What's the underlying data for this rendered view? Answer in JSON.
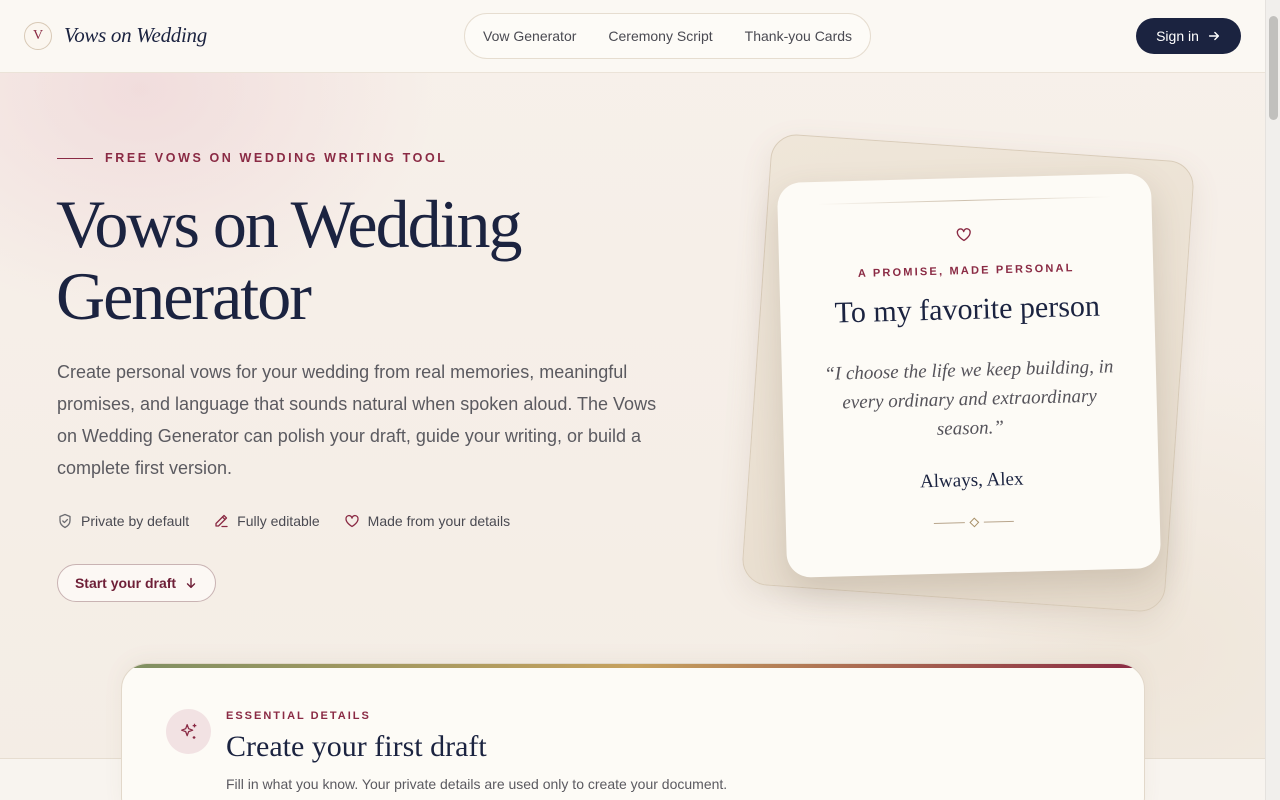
{
  "header": {
    "logo_mark": "V",
    "logo_text": "Vows on Wedding",
    "nav": [
      "Vow Generator",
      "Ceremony Script",
      "Thank-you Cards"
    ],
    "signin_label": "Sign in"
  },
  "hero": {
    "eyebrow": "FREE VOWS ON WEDDING WRITING TOOL",
    "title": "Vows on Wedding Generator",
    "description": "Create personal vows for your wedding from real memories, meaningful promises, and language that sounds natural when spoken aloud. The Vows on Wedding Generator can polish your draft, guide your writing, or build a complete first version.",
    "features": [
      {
        "icon": "shield-check-icon",
        "label": "Private by default"
      },
      {
        "icon": "pencil-icon",
        "label": "Fully editable"
      },
      {
        "icon": "heart-icon",
        "label": "Made from your details"
      }
    ],
    "cta_label": "Start your draft"
  },
  "card": {
    "eyebrow": "A PROMISE, MADE PERSONAL",
    "title": "To my favorite person",
    "quote": "“I choose the life we keep building, in every ordinary and extraordinary season.”",
    "signature": "Always, Alex"
  },
  "form": {
    "eyebrow": "ESSENTIAL DETAILS",
    "title": "Create your first draft",
    "subtitle": "Fill in what you know. Your private details are used only to create your document."
  },
  "colors": {
    "navy": "#1b2340",
    "burgundy": "#8a2a44",
    "cream": "#fdfbf6"
  }
}
